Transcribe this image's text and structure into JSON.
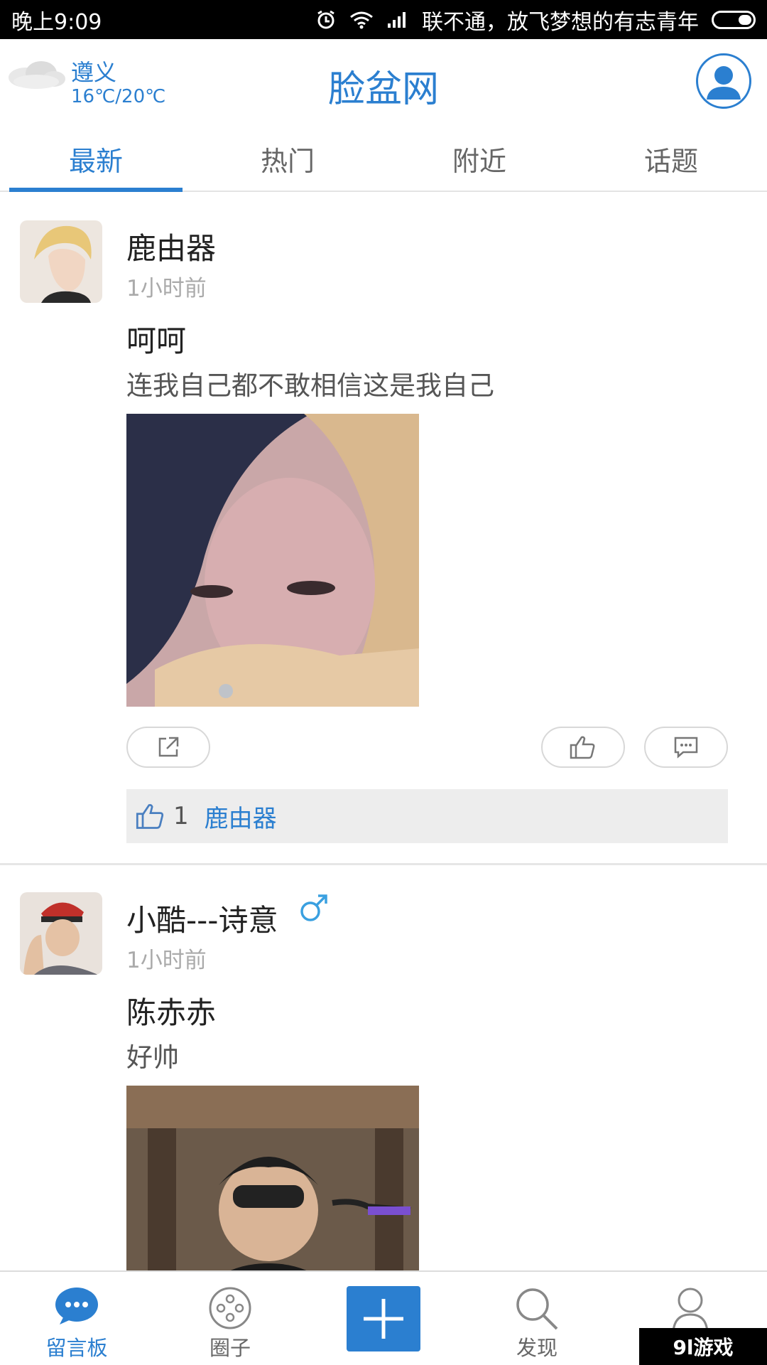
{
  "status_bar": {
    "time": "晚上9:09",
    "carrier": "联不通，放飞梦想的有志青年"
  },
  "header": {
    "city": "遵义",
    "temperature": "16℃/20℃",
    "title": "脸盆网"
  },
  "tabs": [
    {
      "label": "最新",
      "active": true
    },
    {
      "label": "热门",
      "active": false
    },
    {
      "label": "附近",
      "active": false
    },
    {
      "label": "话题",
      "active": false
    }
  ],
  "posts": [
    {
      "author": "鹿由器",
      "time": "1小时前",
      "title": "呵呵",
      "text": "连我自己都不敢相信这是我自己",
      "like_count": "1",
      "liked_by": "鹿由器"
    },
    {
      "author": "小酷---诗意",
      "gender": "♂",
      "time": "1小时前",
      "title": "陈赤赤",
      "text": "好帅"
    }
  ],
  "bottom_nav": [
    {
      "label": "留言板",
      "icon": "chat-bubble-icon",
      "active": true
    },
    {
      "label": "圈子",
      "icon": "circle-dots-icon",
      "active": false
    },
    {
      "label": "",
      "icon": "plus-icon",
      "active": false
    },
    {
      "label": "发现",
      "icon": "search-icon",
      "active": false
    },
    {
      "label": "",
      "icon": "user-icon",
      "active": false
    }
  ],
  "watermark": "9l游戏",
  "colors": {
    "accent": "#2b7fd0",
    "status_bar_bg": "#000000",
    "likes_bar_bg": "#ededed"
  }
}
